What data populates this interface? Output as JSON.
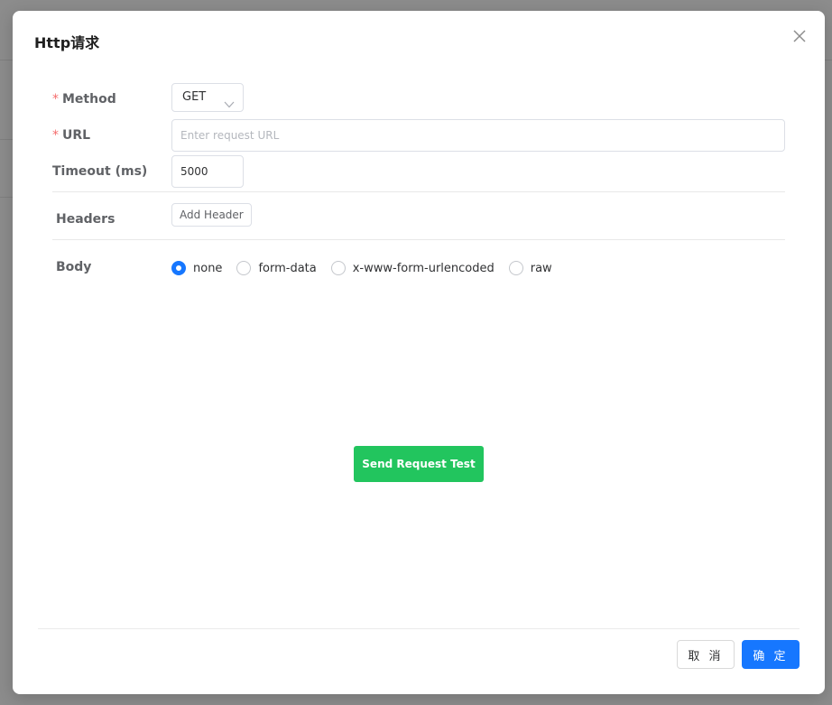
{
  "dialog": {
    "title": "Http请求",
    "close_icon": "close-icon"
  },
  "form": {
    "method": {
      "label": "Method",
      "required": true,
      "value": "GET"
    },
    "url": {
      "label": "URL",
      "required": true,
      "value": "",
      "placeholder": "Enter request URL"
    },
    "timeout": {
      "label": "Timeout (ms)",
      "value": "5000"
    },
    "headers": {
      "label": "Headers",
      "add_label": "Add Header"
    },
    "body": {
      "label": "Body",
      "options": [
        {
          "label": "none",
          "checked": true
        },
        {
          "label": "form-data",
          "checked": false
        },
        {
          "label": "x-www-form-urlencoded",
          "checked": false
        },
        {
          "label": "raw",
          "checked": false
        }
      ]
    },
    "send_label": "Send Request Test"
  },
  "footer": {
    "cancel_label": "取 消",
    "ok_label": "确 定"
  },
  "colors": {
    "primary": "#1677ff",
    "success": "#22c55e",
    "required": "#f56c6c"
  }
}
